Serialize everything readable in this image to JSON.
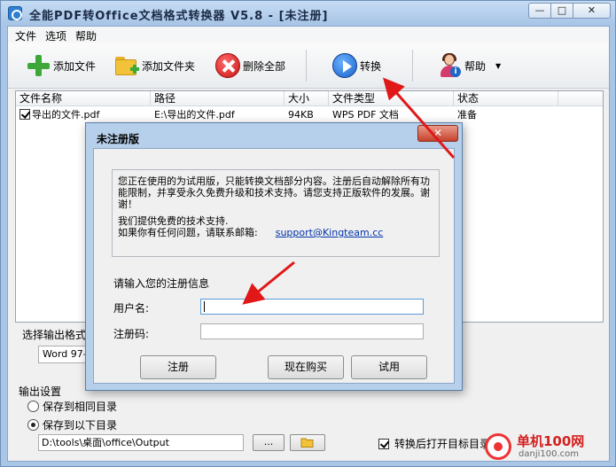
{
  "window": {
    "title": "全能PDF转Office文档格式转换器 V5.8  -  [未注册]",
    "min_glyph": "—",
    "max_glyph": "□",
    "close_glyph": "✕"
  },
  "menu": [
    "文件",
    "选项",
    "帮助"
  ],
  "toolbar": {
    "add_file": "添加文件",
    "add_folder": "添加文件夹",
    "delete_all": "删除全部",
    "convert": "转换",
    "help": "帮助",
    "dropdown_glyph": "▼"
  },
  "table": {
    "headers": [
      "文件名称",
      "路径",
      "大小",
      "文件类型",
      "状态"
    ],
    "rows": [
      {
        "name": "导出的文件.pdf",
        "path": "E:\\导出的文件.pdf",
        "size": "94KB",
        "type": "WPS PDF 文档",
        "status": "准备"
      }
    ]
  },
  "output_format": {
    "label": "选择输出格式",
    "selected": "Word 97-2"
  },
  "output_settings": {
    "title": "输出设置",
    "option_same": "保存到相同目录",
    "option_below": "保存到以下目录",
    "path": "D:\\tools\\桌面\\office\\Output",
    "browse": "...",
    "open_after": "转换后打开目标目录"
  },
  "watermark": {
    "name": "单机100网",
    "url": "danji100.com"
  },
  "dialog": {
    "title": "未注册版",
    "close_glyph": "✕",
    "notice_line1": "您正在使用的为试用版，只能转换文档部分内容。注册后自动解除所有功能限制，并享受永久免费升级和技术支持。请您支持正版软件的发展。谢谢！",
    "notice_line2": "我们提供免费的技术支持.",
    "notice_line3": "如果你有任何问题，请联系邮箱:",
    "email": "support@Kingteam.cc",
    "prompt": "请输入您的注册信息",
    "username_label": "用户名:",
    "username_value": "",
    "code_label": "注册码:",
    "code_value": "",
    "register": "注册",
    "buy": "现在购买",
    "trial": "试用"
  }
}
